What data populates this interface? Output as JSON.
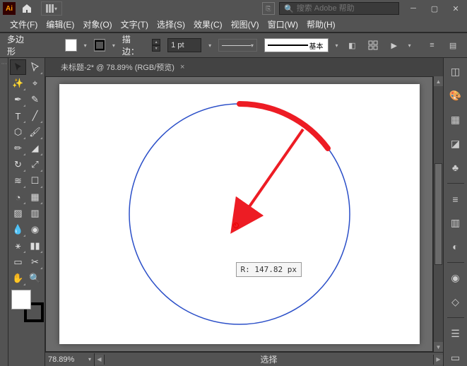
{
  "titlebar": {
    "search_placeholder": "搜索 Adobe 帮助",
    "search_icon": "🔍"
  },
  "menu": {
    "file": "文件(F)",
    "edit": "编辑(E)",
    "object": "对象(O)",
    "type": "文字(T)",
    "select": "选择(S)",
    "effect": "效果(C)",
    "view": "视图(V)",
    "window": "窗口(W)",
    "help": "帮助(H)"
  },
  "options": {
    "shape": "多边形",
    "stroke_label": "描边：",
    "stroke_value": "1 pt",
    "profile_label": "基本"
  },
  "tab": {
    "title": "未标题-2* @ 78.89% (RGB/预览)",
    "close": "×"
  },
  "tooltip": {
    "text": "R: 147.82 px"
  },
  "status": {
    "zoom": "78.89%",
    "mode": "选择"
  },
  "icons": {
    "ai": "Ai"
  }
}
